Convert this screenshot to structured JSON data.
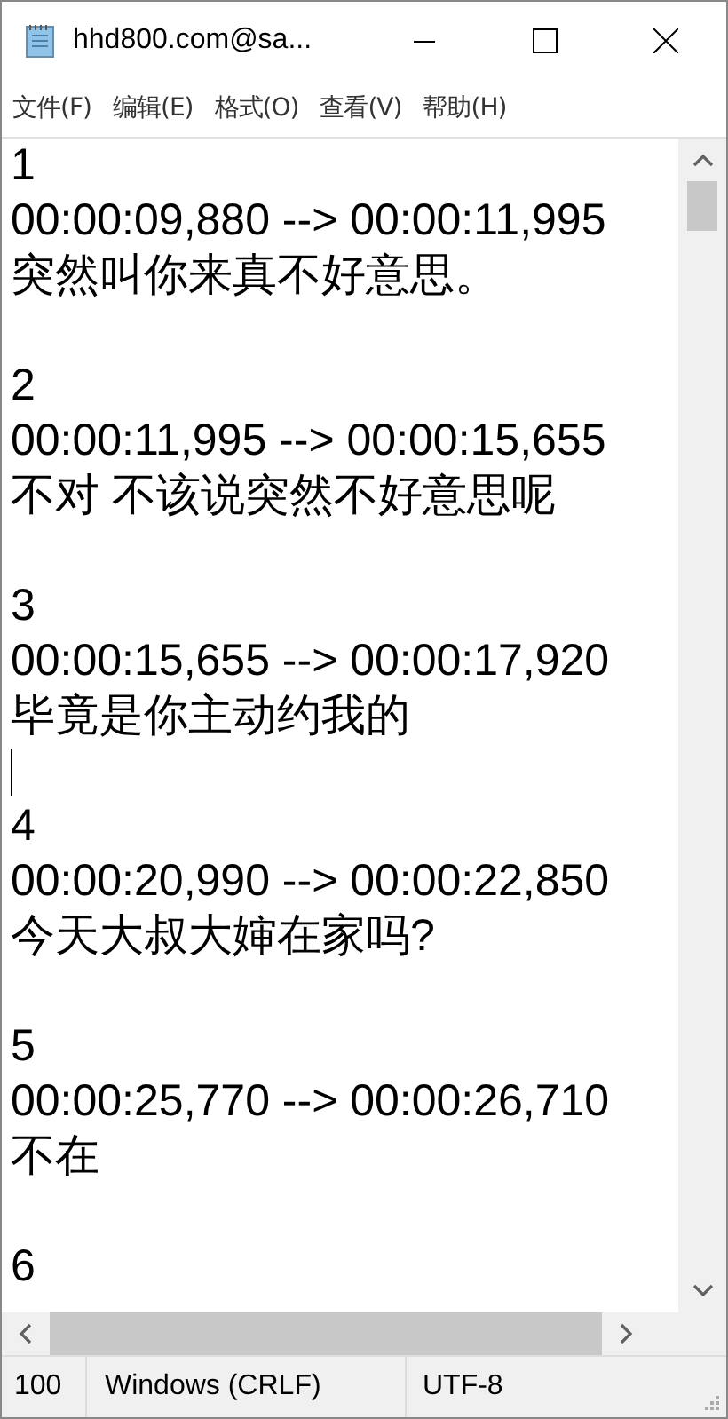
{
  "window": {
    "title": "hhd800.com@sa..."
  },
  "menu": [
    "文件(F)",
    "编辑(E)",
    "格式(O)",
    "查看(V)",
    "帮助(H)"
  ],
  "entries": [
    {
      "number": "1",
      "time": "00:00:09,880 --> 00:00:11,995",
      "text": "突然叫你来真不好意思。",
      "caret_after": false
    },
    {
      "number": "2",
      "time": "00:00:11,995 --> 00:00:15,655",
      "text": "不对 不该说突然不好意思呢",
      "caret_after": false
    },
    {
      "number": "3",
      "time": "00:00:15,655 --> 00:00:17,920",
      "text": "毕竟是你主动约我的",
      "caret_after": true
    },
    {
      "number": "4",
      "time": "00:00:20,990 --> 00:00:22,850",
      "text": "今天大叔大婶在家吗?",
      "caret_after": false
    },
    {
      "number": "5",
      "time": "00:00:25,770 --> 00:00:26,710",
      "text": "不在",
      "caret_after": false
    },
    {
      "number": "6"
    }
  ],
  "status_bar": {
    "zoom": "100",
    "line_ending": "Windows (CRLF)",
    "encoding": "UTF-8"
  }
}
